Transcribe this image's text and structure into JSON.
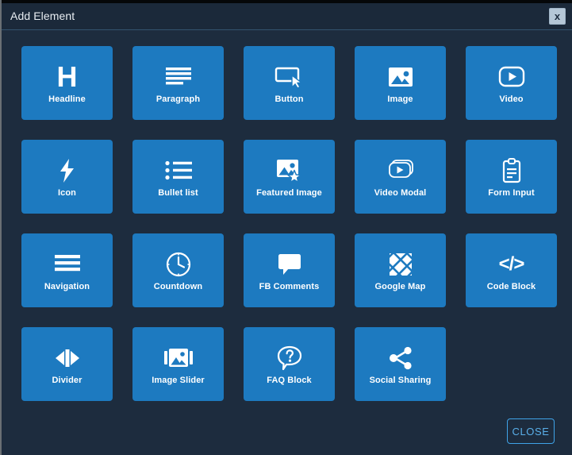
{
  "window": {
    "title": "Add Element",
    "close_icon_label": "x",
    "accent_color": "#1d7ac0",
    "background_color": "#1d2c3e",
    "titlebar_color": "#1b293a",
    "close_button_color": "#b5c7d7",
    "footer_button_border_color": "#3fa3e8"
  },
  "elements": [
    {
      "label": "Headline",
      "icon": "headline-icon"
    },
    {
      "label": "Paragraph",
      "icon": "paragraph-icon"
    },
    {
      "label": "Button",
      "icon": "button-cursor-icon"
    },
    {
      "label": "Image",
      "icon": "image-icon"
    },
    {
      "label": "Video",
      "icon": "video-play-icon"
    },
    {
      "label": "Icon",
      "icon": "lightning-bolt-icon"
    },
    {
      "label": "Bullet list",
      "icon": "bullet-list-icon"
    },
    {
      "label": "Featured Image",
      "icon": "featured-image-star-icon"
    },
    {
      "label": "Video Modal",
      "icon": "video-modal-icon"
    },
    {
      "label": "Form Input",
      "icon": "clipboard-form-icon"
    },
    {
      "label": "Navigation",
      "icon": "hamburger-menu-icon"
    },
    {
      "label": "Countdown",
      "icon": "clock-icon"
    },
    {
      "label": "FB Comments",
      "icon": "speech-bubble-icon"
    },
    {
      "label": "Google Map",
      "icon": "map-grid-icon"
    },
    {
      "label": "Code Block",
      "icon": "code-brackets-icon"
    },
    {
      "label": "Divider",
      "icon": "divider-arrows-icon"
    },
    {
      "label": "Image Slider",
      "icon": "image-slider-icon"
    },
    {
      "label": "FAQ Block",
      "icon": "question-bubble-icon"
    },
    {
      "label": "Social Sharing",
      "icon": "share-nodes-icon"
    }
  ],
  "footer": {
    "close_label": "CLOSE"
  }
}
